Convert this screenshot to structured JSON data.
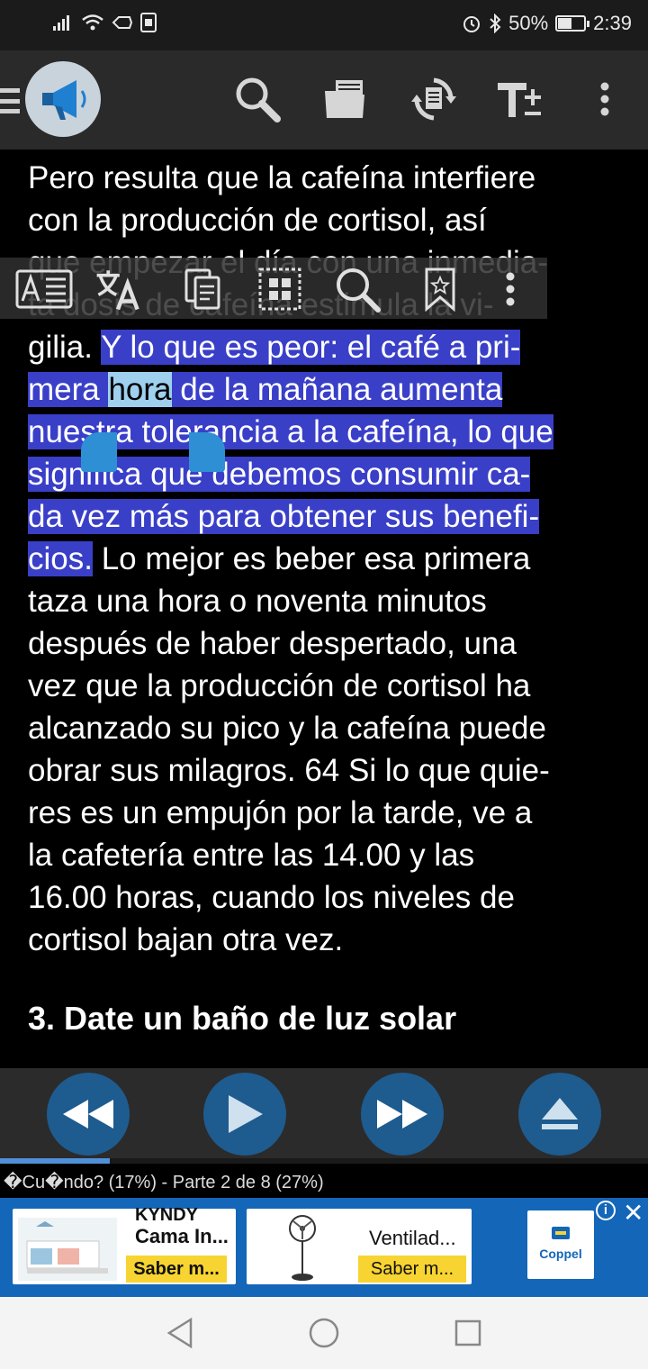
{
  "status_bar": {
    "battery": "50%",
    "time": "2:39",
    "battery_level": 0.5
  },
  "toolbar": {
    "icons": [
      "menu-icon",
      "megaphone-icon",
      "search-icon",
      "folder-icon",
      "sync-icon",
      "text-size-icon",
      "more-vert-icon"
    ]
  },
  "content": {
    "lines": [
      "Pero resulta que la cafeína interfiere",
      "con la producción de cortisol, así",
      "que empezar el día con una inmedia-",
      "ta dosis de cafeína estimula la vi-",
      "gilia.",
      "Y lo que es peor: el café a pri-",
      "mera ",
      "hora",
      " de la mañana aumenta",
      "nuestra tolerancia a la cafeína, lo que",
      "significa que debemos consumir ca-",
      "da vez más para obtener sus benefi-",
      "cios.",
      " Lo mejor es beber esa primera",
      "taza una hora o noventa minutos",
      "después de haber despertado, una",
      "vez que la producción de cortisol ha",
      "alcanzado su pico y la cafeína puede",
      "obrar sus milagros. 64 Si lo que quie-",
      "res es un empujón por la tarde, ve a",
      "la cafetería entre las 14.00 y las",
      "16.00 horas, cuando los niveles de",
      "cortisol bajan otra vez."
    ],
    "heading": "3. Date un baño de luz solar"
  },
  "selection_popup": {
    "icons": [
      "reader-mode-icon",
      "translate-icon",
      "copy-icon",
      "select-all-icon",
      "search-icon",
      "bookmark-icon",
      "more-vert-icon"
    ]
  },
  "media": {
    "buttons": [
      "rewind-icon",
      "play-icon",
      "fast-forward-icon",
      "eject-icon"
    ]
  },
  "progress": {
    "text": "�Cu�ndo? (17%) - Parte 2 de 8 (27%)",
    "fraction": 0.17
  },
  "ad": {
    "card1_brand": "KYNDY",
    "card1_title": "Cama In...",
    "card1_cta": "Saber m...",
    "card2_title": "Ventilad...",
    "card2_cta": "Saber m...",
    "advertiser": "Coppel",
    "info": "i",
    "close": "✕",
    "colors": {
      "background": "#1466b8",
      "cta": "#f7d431"
    }
  },
  "colors": {
    "highlight": "#3a3fc8",
    "selected_word": "#9fd1ef",
    "media_button": "#1e5b8f",
    "progress": "#4f91d8"
  }
}
